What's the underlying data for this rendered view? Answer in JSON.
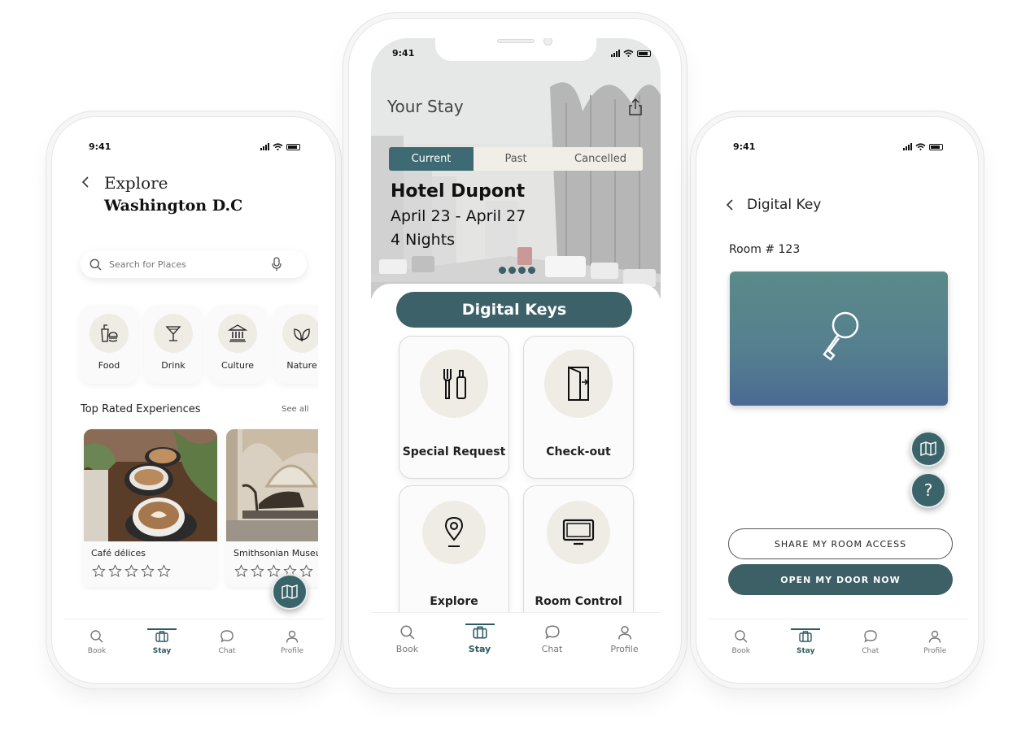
{
  "status": {
    "time": "9:41"
  },
  "explore_screen": {
    "title_line1": "Explore",
    "title_line2": "Washington D.C",
    "search": {
      "placeholder": "Search for Places"
    },
    "categories": [
      {
        "label": "Food",
        "icon": "food-icon"
      },
      {
        "label": "Drink",
        "icon": "cocktail-icon"
      },
      {
        "label": "Culture",
        "icon": "museum-icon"
      },
      {
        "label": "Nature",
        "icon": "leaf-icon"
      }
    ],
    "section_title": "Top Rated Experiences",
    "see_all": "See all",
    "experiences": [
      {
        "name": "Café délices",
        "rating": 0
      },
      {
        "name": "Smithsonian Museu",
        "rating": 0
      }
    ]
  },
  "stay_screen": {
    "title": "Your Stay",
    "segments": [
      "Current",
      "Past",
      "Cancelled"
    ],
    "active_segment": "Current",
    "hotel": "Hotel Dupont",
    "dates": "April 23 - April 27",
    "nights": "4 Nights",
    "digital_keys_label": "Digital Keys",
    "tiles": [
      {
        "label": "Special Request",
        "icon": "toiletries-icon"
      },
      {
        "label": "Check-out",
        "icon": "door-exit-icon"
      },
      {
        "label": "Explore",
        "icon": "map-pin-icon"
      },
      {
        "label": "Room Control",
        "icon": "tv-icon"
      }
    ]
  },
  "key_screen": {
    "title": "Digital Key",
    "room": "Room # 123",
    "share_button": "SHARE MY ROOM ACCESS",
    "open_button": "OPEN MY DOOR NOW",
    "help_label": "?"
  },
  "tabs": [
    "Book",
    "Stay",
    "Chat",
    "Profile"
  ],
  "active_tab": "Stay",
  "colors": {
    "accent": "#2d5a63",
    "tile_bg": "#efece6",
    "key_card_top": "#5a8a8a",
    "key_card_bottom": "#4a6a94"
  }
}
